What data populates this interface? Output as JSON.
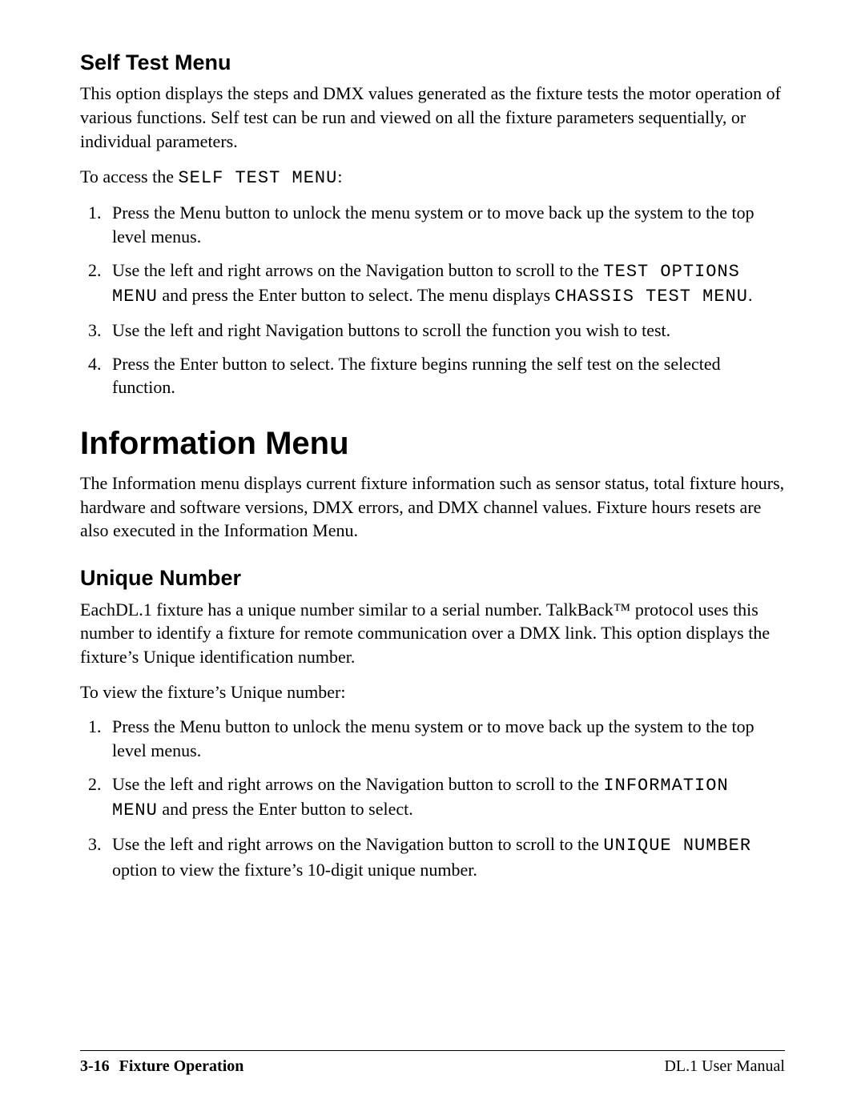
{
  "selfTest": {
    "heading": "Self Test Menu",
    "intro": "This option displays the steps and DMX values generated as the fixture tests the motor operation of various functions. Self test can be run and viewed on all the fixture parameters sequentially, or individual parameters.",
    "accessLead": "To access the ",
    "accessMono": "SELF TEST MENU",
    "accessTail": ":",
    "step1": "Press the Menu button to unlock the menu system or to move back up the system to the top level menus.",
    "step2a": "Use the left and right arrows on the Navigation button to scroll to the ",
    "step2mono1": "TEST OPTIONS MENU",
    "step2b": " and press the Enter button to select. The menu displays ",
    "step2mono2": "CHASSIS TEST MENU",
    "step2c": ".",
    "step3": "Use the left and right Navigation buttons to scroll the function you wish to test.",
    "step4": "Press the Enter button to select. The fixture begins running the self test on the selected function."
  },
  "infoMenu": {
    "heading": "Information Menu",
    "intro": "The Information menu displays current fixture information such as sensor status, total fixture hours, hardware and software versions, DMX errors, and DMX channel values. Fixture hours resets are also executed in the Information Menu."
  },
  "unique": {
    "heading": "Unique Number",
    "intro": "EachDL.1 fixture has a unique number similar to a serial number. TalkBack™ protocol uses this number to identify a fixture for remote communication over a DMX link. This option displays the  fixture’s Unique  identification number.",
    "viewLead": "To view the fixture’s Unique number:",
    "step1": "Press the Menu button to unlock the menu system or to move back up the system to the top level menus.",
    "step2a": "Use the left and right arrows on the Navigation button to scroll to the ",
    "step2mono": "INFORMATION MENU",
    "step2b": " and press the Enter button to select.",
    "step3a": "Use the left and right arrows on the Navigation button to scroll to the ",
    "step3mono": "UNIQUE NUMBER",
    "step3b": " option to view the fixture’s 10-digit unique number."
  },
  "footer": {
    "page": "3-16",
    "chapter": "Fixture Operation",
    "manual": "DL.1 User Manual"
  }
}
